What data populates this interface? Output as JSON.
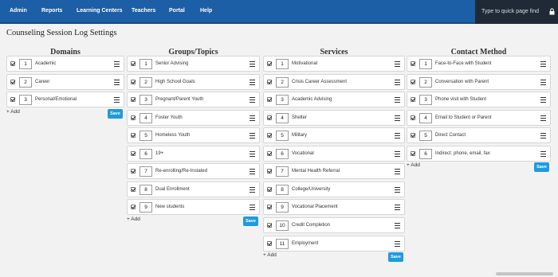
{
  "nav": {
    "items": [
      "Admin",
      "Reports",
      "Learning Centers",
      "Teachers",
      "Portal",
      "Help"
    ],
    "quick_find_placeholder": "Type to quick page find"
  },
  "page": {
    "title": "Counseling Session Log Settings"
  },
  "columns": [
    {
      "title": "Domains",
      "items": [
        {
          "num": "1",
          "label": "Academic"
        },
        {
          "num": "2",
          "label": "Career"
        },
        {
          "num": "3",
          "label": "Personal/Emotional"
        }
      ],
      "add_label": "+ Add",
      "save_label": "Save"
    },
    {
      "title": "Groups/Topics",
      "items": [
        {
          "num": "1",
          "label": "Senior Advising"
        },
        {
          "num": "2",
          "label": "High School Goals"
        },
        {
          "num": "3",
          "label": "Pregnant/Parent Youth"
        },
        {
          "num": "4",
          "label": "Foster Youth"
        },
        {
          "num": "5",
          "label": "Homeless Youth"
        },
        {
          "num": "6",
          "label": "19+"
        },
        {
          "num": "7",
          "label": "Re-enrolling/Re-Instated"
        },
        {
          "num": "8",
          "label": "Dual Enrollment"
        },
        {
          "num": "9",
          "label": "New students"
        }
      ],
      "add_label": "+ Add",
      "save_label": "Save"
    },
    {
      "title": "Services",
      "items": [
        {
          "num": "1",
          "label": "Motivational"
        },
        {
          "num": "2",
          "label": "Crisis Career Assessment"
        },
        {
          "num": "3",
          "label": "Academic Advising"
        },
        {
          "num": "4",
          "label": "Shelter"
        },
        {
          "num": "5",
          "label": "Military"
        },
        {
          "num": "6",
          "label": "Vocational"
        },
        {
          "num": "7",
          "label": "Mental Health Referral"
        },
        {
          "num": "8",
          "label": "College/University"
        },
        {
          "num": "9",
          "label": "Vocational Placement"
        },
        {
          "num": "10",
          "label": "Credit Completion"
        },
        {
          "num": "11",
          "label": "Employment"
        }
      ],
      "add_label": "+ Add",
      "save_label": "Save"
    },
    {
      "title": "Contact Method",
      "items": [
        {
          "num": "1",
          "label": "Face-to-Face with Student"
        },
        {
          "num": "2",
          "label": "Conversation with Parent"
        },
        {
          "num": "3",
          "label": "Phone visit with Student"
        },
        {
          "num": "4",
          "label": "Email to Student or Parent"
        },
        {
          "num": "5",
          "label": "Direct Contact"
        },
        {
          "num": "6",
          "label": "Indirect: phone, email, fax"
        }
      ],
      "add_label": "+ Add",
      "save_label": "Save"
    }
  ],
  "colors": {
    "nav": "#1d5fa6",
    "quick_find": "#202a36",
    "save": "#1e9be0"
  }
}
